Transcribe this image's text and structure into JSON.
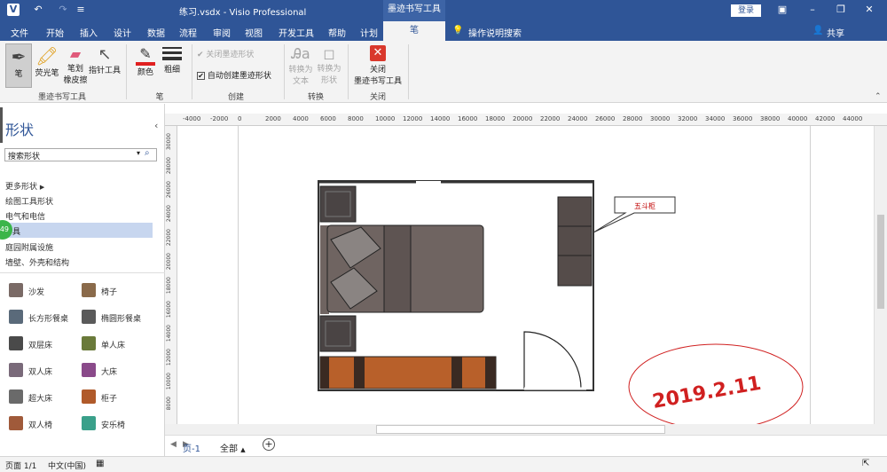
{
  "titlebar": {
    "doc_title": "练习.vsdx - Visio Professional",
    "context_tab": "墨迹书写工具",
    "login": "登录"
  },
  "tabs": [
    "文件",
    "开始",
    "插入",
    "设计",
    "数据",
    "流程",
    "审阅",
    "视图",
    "开发工具",
    "帮助",
    "计划",
    "笔"
  ],
  "tell_me": "操作说明搜索",
  "share": "共享",
  "ribbon": {
    "pen": "笔",
    "highlighter": "荧光笔",
    "eraser_line1": "笔划",
    "eraser_line2": "橡皮擦",
    "pointer": "指针工具",
    "group_ink": "墨迹书写工具",
    "color": "颜色",
    "thickness": "粗细",
    "group_pen": "笔",
    "close_ink_shape": "关闭墨迹形状",
    "auto_create": "自动创建墨迹形状",
    "group_create": "创建",
    "convert_text_1": "转换为",
    "convert_text_2": "文本",
    "convert_shape_1": "转换为",
    "convert_shape_2": "形状",
    "group_convert": "转换",
    "close_tools_1": "关闭",
    "close_tools_2": "墨迹书写工具",
    "group_close": "关闭"
  },
  "shapes_panel": {
    "title": "形状",
    "search_value": "搜索形状",
    "more_shapes": "更多形状",
    "categories": [
      "绘图工具形状",
      "电气和电信",
      "具",
      "庭园附属设施",
      "墙壁、外壳和结构"
    ],
    "badge": "49",
    "items": [
      {
        "label": "沙发",
        "color": "#7a6a66"
      },
      {
        "label": "椅子",
        "color": "#8a6a4a"
      },
      {
        "label": "长方形餐桌",
        "color": "#5a6a7a"
      },
      {
        "label": "椭圆形餐桌",
        "color": "#5a5a5a"
      },
      {
        "label": "双层床",
        "color": "#4a4a4a"
      },
      {
        "label": "单人床",
        "color": "#6a7a3a"
      },
      {
        "label": "双人床",
        "color": "#7a6a7a"
      },
      {
        "label": "大床",
        "color": "#8a4a8a"
      },
      {
        "label": "超大床",
        "color": "#6a6a6a"
      },
      {
        "label": "柜子",
        "color": "#b05a2a"
      },
      {
        "label": "双人椅",
        "color": "#a05a3a"
      },
      {
        "label": "安乐椅",
        "color": "#3aa08a"
      }
    ]
  },
  "ruler_h": [
    "-4000",
    "-2000",
    "0",
    "2000",
    "4000",
    "6000",
    "8000",
    "10000",
    "12000",
    "14000",
    "16000",
    "18000",
    "20000",
    "22000",
    "24000",
    "26000",
    "28000",
    "30000",
    "32000",
    "34000",
    "36000",
    "38000",
    "40000",
    "42000",
    "44000"
  ],
  "ruler_v": [
    "30000",
    "28000",
    "26000",
    "24000",
    "22000",
    "20000",
    "18000",
    "16000",
    "14000",
    "12000",
    "10000",
    "8000"
  ],
  "drawing": {
    "callout": "五斗柜",
    "handwriting": "2019.2.11"
  },
  "pagebar": {
    "page": "页-1",
    "all": "全部"
  },
  "status": {
    "page_info": "页面 1/1",
    "language": "中文(中国)"
  }
}
